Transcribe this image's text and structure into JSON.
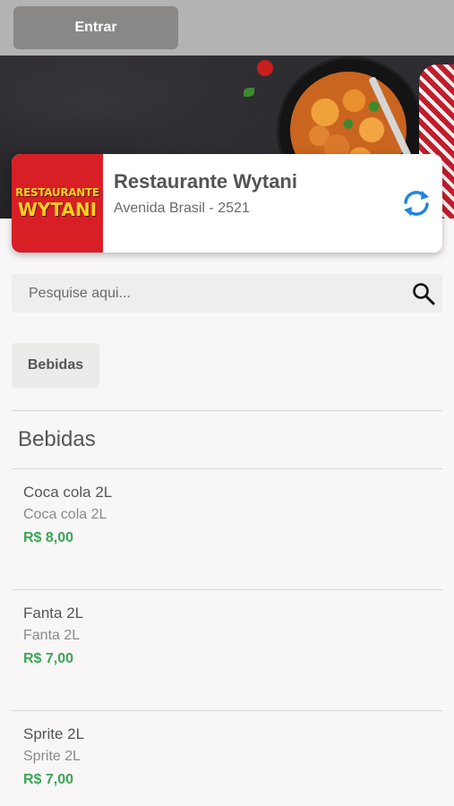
{
  "header": {
    "login_label": "Entrar"
  },
  "restaurant": {
    "logo_line1": "RESTAURANTE",
    "logo_line2": "WYTANI",
    "name": "Restaurante Wytani",
    "address": "Avenida Brasil - 2521"
  },
  "search": {
    "placeholder": "Pesquise aqui..."
  },
  "categories": [
    {
      "label": "Bebidas"
    }
  ],
  "section": {
    "title": "Bebidas"
  },
  "items": [
    {
      "name": "Coca cola 2L",
      "description": "Coca cola 2L",
      "price": "R$ 8,00"
    },
    {
      "name": "Fanta 2L",
      "description": "Fanta 2L",
      "price": "R$ 7,00"
    },
    {
      "name": "Sprite 2L",
      "description": "Sprite 2L",
      "price": "R$ 7,00"
    }
  ],
  "colors": {
    "price": "#3aa657",
    "accent_icon": "#1f86e0",
    "logo_bg": "#d81f26"
  },
  "icons": {
    "refresh": "refresh-icon",
    "search": "search-icon"
  }
}
